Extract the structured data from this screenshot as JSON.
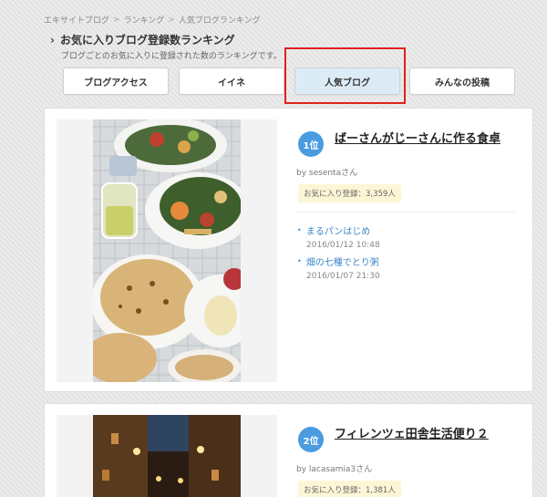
{
  "breadcrumb": [
    "エキサイトブログ",
    "ランキング",
    "人気ブログランキング"
  ],
  "heading": {
    "title": "お気に入りブログ登録数ランキング",
    "subtitle": "ブログごとのお気に入りに登録された数のランキングです。"
  },
  "tabs": [
    {
      "label": "ブログアクセス",
      "active": false
    },
    {
      "label": "イイネ",
      "active": false
    },
    {
      "label": "人気ブログ",
      "active": true
    },
    {
      "label": "みんなの投稿",
      "active": false
    }
  ],
  "colors": {
    "accent": "#4a9be0",
    "highlight_box": "#e0201e",
    "link": "#3b88c8",
    "fav_badge_bg": "#fdf6d6",
    "active_tab_bg": "#dcecf7"
  },
  "rankings": [
    {
      "rank": "1位",
      "title": "ばーさんがじーさんに作る食卓",
      "author": "by sesentaさん",
      "favorites": "お気に入り登録：3,359人",
      "posts": [
        {
          "title": "まるパンはじめ",
          "date": "2016/01/12 10:48"
        },
        {
          "title": "畑の七種でとり粥",
          "date": "2016/01/07 21:30"
        }
      ]
    },
    {
      "rank": "2位",
      "title": "フィレンツェ田舎生活便り２",
      "author": "by lacasamia3さん",
      "favorites": "お気に入り登録：1,381人"
    }
  ]
}
